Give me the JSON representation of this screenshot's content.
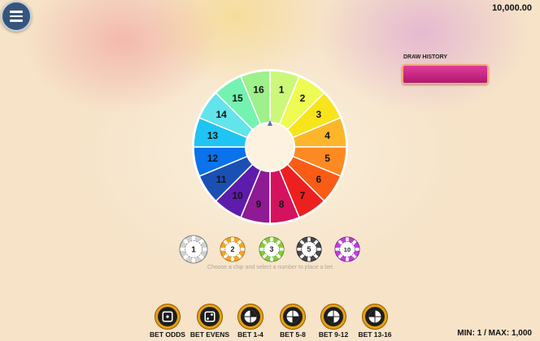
{
  "balance": "10,000.00",
  "draw_history": {
    "label": "DRAW HISTORY"
  },
  "wheel": {
    "numbers": [
      "1",
      "2",
      "3",
      "4",
      "5",
      "6",
      "7",
      "8",
      "9",
      "10",
      "11",
      "12",
      "13",
      "14",
      "15",
      "16"
    ],
    "colors": [
      "#ccf87a",
      "#eefb52",
      "#f8e41c",
      "#fdb62a",
      "#fd8a22",
      "#fa5c16",
      "#ed2020",
      "#d4125e",
      "#8e1a94",
      "#5e1cad",
      "#1a50b4",
      "#0a72eb",
      "#20c4f4",
      "#62e4ea",
      "#74f2b0",
      "#9ef08a"
    ]
  },
  "chips": [
    {
      "value": "1",
      "color": "#d2d2d2",
      "stroke": "#7a7a7a"
    },
    {
      "value": "2",
      "color": "#f0a628",
      "stroke": "#b06a10"
    },
    {
      "value": "3",
      "color": "#88cc38",
      "stroke": "#4a8a18"
    },
    {
      "value": "5",
      "color": "#4a4a4a",
      "stroke": "#1a1a1a"
    },
    {
      "value": "10",
      "color": "#c040d8",
      "stroke": "#7a1898"
    }
  ],
  "hint": "Choose a chip and select a number to place a bet",
  "bets": [
    {
      "label": "BET ODDS",
      "icon": "die-one-icon"
    },
    {
      "label": "BET EVENS",
      "icon": "die-two-icon"
    },
    {
      "label": "BET 1-4",
      "icon": "quarter-1-icon"
    },
    {
      "label": "BET 5-8",
      "icon": "quarter-2-icon"
    },
    {
      "label": "BET 9-12",
      "icon": "quarter-3-icon"
    },
    {
      "label": "BET 13-16",
      "icon": "quarter-4-icon"
    }
  ],
  "limits": "MIN: 1 / MAX: 1,000"
}
